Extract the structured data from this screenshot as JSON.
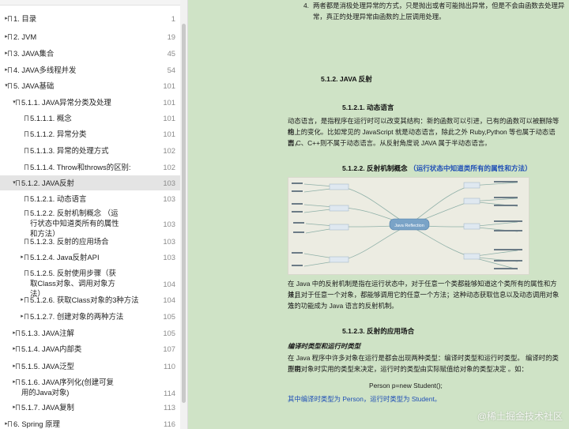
{
  "toc": {
    "items": [
      {
        "label": "1. 目录",
        "page": "1",
        "level": 0,
        "expand": "▸"
      },
      {
        "label": "2. JVM",
        "page": "19",
        "level": 0,
        "expand": "▸"
      },
      {
        "label": "3. JAVA集合",
        "page": "45",
        "level": 0,
        "expand": "▸"
      },
      {
        "label": "4. JAVA多线程并发",
        "page": "54",
        "level": 0,
        "expand": "▸"
      },
      {
        "label": "5. JAVA基础",
        "page": "101",
        "level": 0,
        "expand": "▾"
      },
      {
        "label": "5.1.1. JAVA异常分类及处理",
        "page": "101",
        "level": 1,
        "expand": "▾"
      },
      {
        "label": "5.1.1.1. 概念",
        "page": "101",
        "level": 2,
        "expand": ""
      },
      {
        "label": "5.1.1.2. 异常分类",
        "page": "101",
        "level": 2,
        "expand": ""
      },
      {
        "label": "5.1.1.3. 异常的处理方式",
        "page": "102",
        "level": 2,
        "expand": ""
      },
      {
        "label": "5.1.1.4. Throw和throws的区别:",
        "page": "102",
        "level": 2,
        "expand": ""
      },
      {
        "label": "5.1.2. JAVA反射",
        "page": "103",
        "level": 1,
        "expand": "▾",
        "selected": true
      },
      {
        "label": "5.1.2.1. 动态语言",
        "page": "103",
        "level": 2,
        "expand": ""
      },
      {
        "label": "5.1.2.2. 反射机制概念 （运行状态中知道类所有的属性和方法）",
        "label2": "中知道类所有的属性和方法）",
        "page": "103",
        "level": 2,
        "expand": ""
      },
      {
        "label": "5.1.2.3. 反射的应用场合",
        "page": "103",
        "level": 2,
        "expand": "",
        "hover": true
      },
      {
        "label": "5.1.2.4. Java反射API",
        "page": "103",
        "level": 2,
        "expand": "▸"
      },
      {
        "label": "5.1.2.5. 反射使用步骤（获取Class对象、调用对象方法）",
        "page": "104",
        "level": 2,
        "expand": ""
      },
      {
        "label": "5.1.2.6. 获取Class对象的3种方法",
        "page": "104",
        "level": 2,
        "expand": "▸"
      },
      {
        "label": "5.1.2.7. 创建对象的两种方法",
        "page": "105",
        "level": 2,
        "expand": "▸"
      },
      {
        "label": "5.1.3. JAVA注解",
        "page": "105",
        "level": 1,
        "expand": "▸"
      },
      {
        "label": "5.1.4. JAVA内部类",
        "page": "107",
        "level": 1,
        "expand": "▸"
      },
      {
        "label": "5.1.5. JAVA泛型",
        "page": "110",
        "level": 1,
        "expand": "▸"
      },
      {
        "label": "5.1.6. JAVA序列化(创建可复用的Java对象)",
        "page": "114",
        "level": 1,
        "expand": "▸"
      },
      {
        "label": "5.1.7. JAVA复制",
        "page": "113",
        "level": 1,
        "expand": "▸"
      },
      {
        "label": "6. Spring 原理",
        "page": "116",
        "level": 0,
        "expand": "▸"
      }
    ]
  },
  "doc": {
    "intro_num": "4.",
    "intro_line1": "两者都是消极处理异常的方式，只是抛出或者可能抛出异常，但是不会由函数去处理异",
    "intro_line2": "常，真正的处理异常由函数的上层调用处理。",
    "h_512": "5.1.2.  JAVA 反射",
    "h_5121": "5.1.2.1.    动态语言",
    "p_dyn1": "动态语言，是指程序在运行时可以改变其结构：新的函数可以引进，已有的函数可以被删除等结",
    "p_dyn2": "构上的变化。比如常见的 JavaScript 就是动态语言，除此之外 Ruby,Python 等也属于动态语言，",
    "p_dyn3": "而 C、C++则不属于动态语言。从反射角度说 JAVA 属于半动态语言。",
    "h_5122": "5.1.2.2.    反射机制概念",
    "h_5122_note": "（运行状态中知道类所有的属性和方法）",
    "mindmap_center": "Java Reflection",
    "p_refl1": "在 Java 中的反射机制是指在运行状态中，对于任意一个类都能够知道这个类所有的属性和方法；",
    "p_refl2": "并且对于任意一个对象，都能够调用它的任意一个方法；这种动态获取信息以及动态调用对象方",
    "p_refl3": "法的功能成为 Java 语言的反射机制。",
    "h_5123": "5.1.2.3.    反射的应用场合",
    "h_sub": "编译时类型和运行时类型",
    "p_app1": "在 Java 程序中许多对象在运行是都会出现两种类型：编译时类型和运行时类型。 编译时的类型由",
    "p_app2": "声明对象时实用的类型来决定，运行时的类型由实际赋值给对象的类型决定 。如：",
    "code": "Person p=new Student();",
    "p_app3": "其中编译时类型为 Person，运行时类型为 Student。"
  },
  "watermark": "@稀土掘金技术社区"
}
